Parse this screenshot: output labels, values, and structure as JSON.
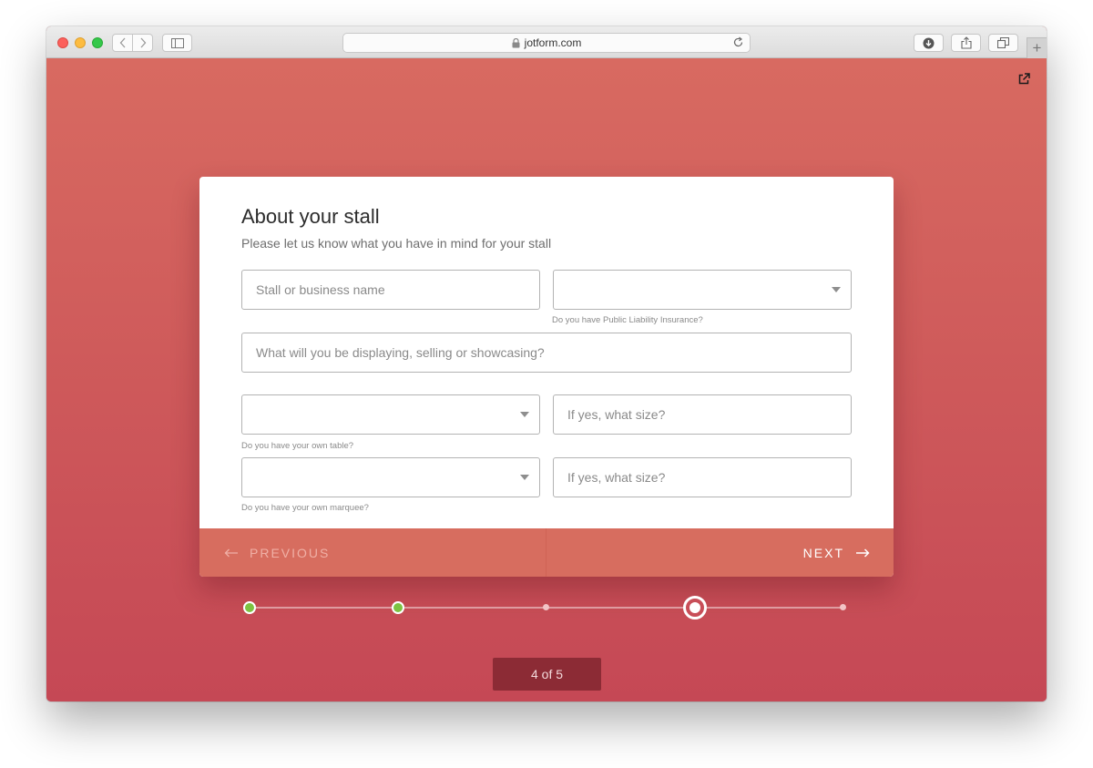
{
  "browser": {
    "url": "jotform.com",
    "icons": {
      "lock": "lock-icon",
      "reload": "reload-icon",
      "back": "chevron-left-icon",
      "forward": "chevron-right-icon",
      "sidebar": "sidebar-icon",
      "download": "download-icon",
      "share": "share-icon",
      "tabs": "tabs-icon",
      "new_tab": "plus-icon"
    },
    "new_tab_label": "+"
  },
  "page": {
    "external_link_icon": "external-link-icon",
    "background_colors": [
      "#d86a61",
      "#c54855"
    ]
  },
  "form": {
    "title": "About your stall",
    "subtitle": "Please let us know what you have in mind for your stall",
    "fields": {
      "stall_name": {
        "placeholder": "Stall or business name",
        "value": ""
      },
      "insurance": {
        "value": "",
        "helper": "Do you have Public Liability Insurance?"
      },
      "display": {
        "placeholder": "What will you be displaying, selling or showcasing?",
        "value": ""
      },
      "own_table": {
        "value": "",
        "helper": "Do you have your own table?"
      },
      "table_size": {
        "placeholder": "If yes, what size?",
        "value": ""
      },
      "own_marquee": {
        "value": "",
        "helper": "Do you have your own marquee?"
      },
      "marquee_size": {
        "placeholder": "If yes, what size?",
        "value": ""
      }
    },
    "nav": {
      "previous_label": "PREVIOUS",
      "next_label": "NEXT"
    }
  },
  "progress": {
    "current": 4,
    "total": 5,
    "label": "4 of 5",
    "steps": [
      "done",
      "done",
      "todo",
      "current",
      "todo"
    ],
    "done_color": "#7cc242"
  }
}
